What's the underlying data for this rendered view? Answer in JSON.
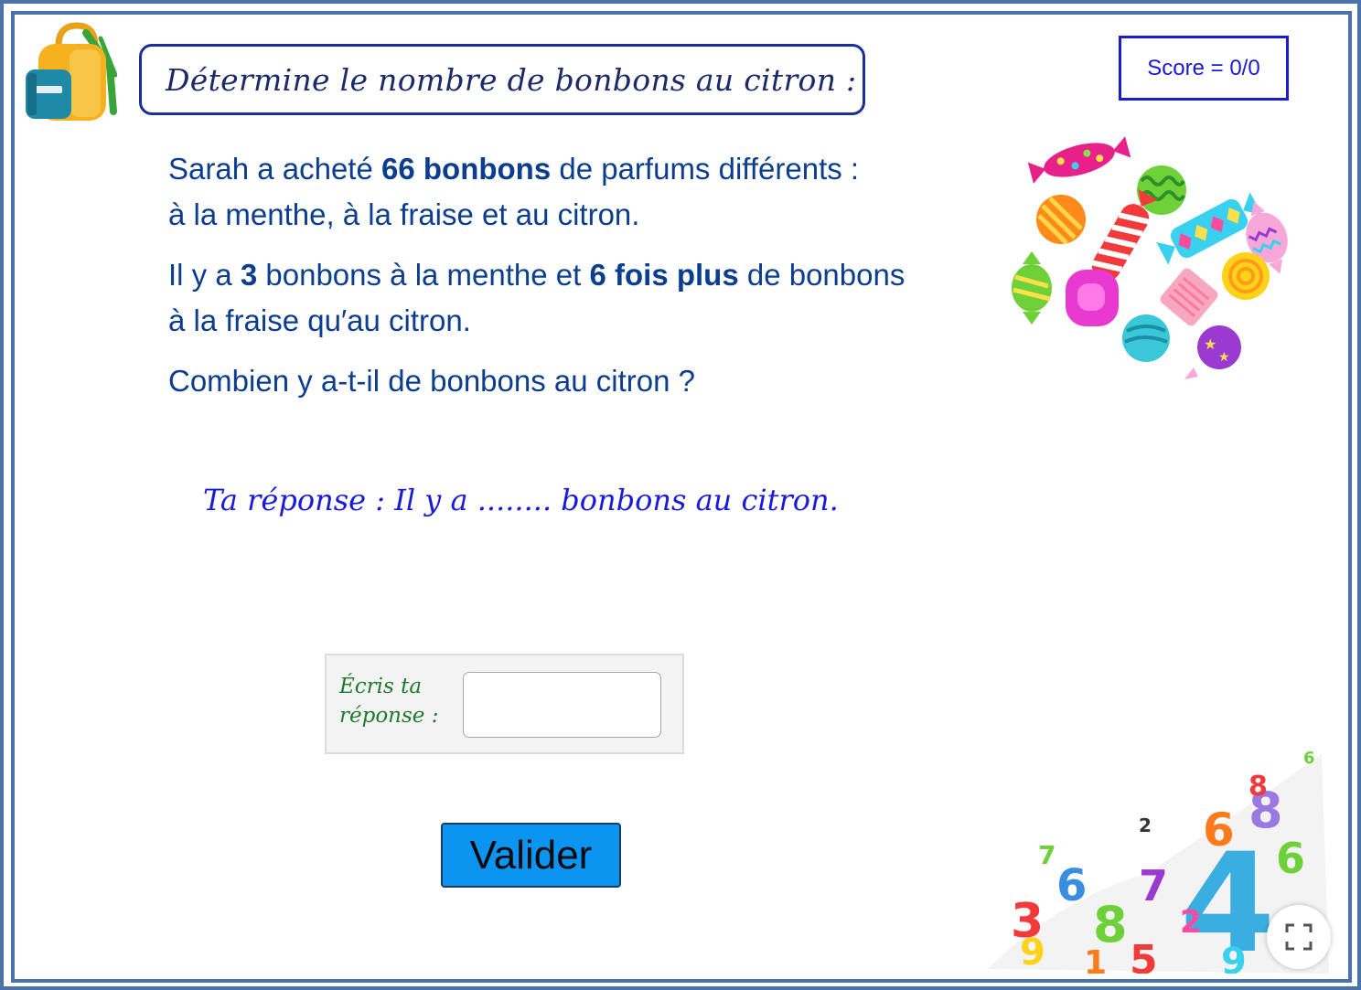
{
  "header": {
    "title": "Détermine le nombre de bonbons au citron :",
    "score": "Score = 0/0"
  },
  "problem": {
    "line1": {
      "a": "Sarah a acheté ",
      "b": "66 bonbons",
      "c": " de parfums différents :"
    },
    "line2": "à la menthe, à la fraise et au citron.",
    "line3": {
      "a": "Il y a ",
      "b": "3",
      "c": " bonbons à la menthe et ",
      "d": "6 fois plus",
      "e": " de bonbons"
    },
    "line4": "à la fraise qu′au citron.",
    "line5": "Combien y a-t-il de bonbons au citron ?"
  },
  "answer_sentence": "Ta réponse : Il y a ........ bonbons au citron.",
  "input": {
    "label_line1": "Écris ta",
    "label_line2": "réponse :",
    "value": ""
  },
  "submit_label": "Valider",
  "icons": {
    "backpack": "backpack-icon",
    "candies": "candies-illustration",
    "numbers": "numbers-illustration",
    "fullscreen": "fullscreen-icon"
  },
  "colors": {
    "frame": "#4a74a8",
    "title_border": "#1a2f9a",
    "score": "#1a1ad0",
    "problem_text": "#0b3d91",
    "answer_text": "#1a1adc",
    "input_label": "#1c7a2a",
    "button": "#0b95f0"
  }
}
